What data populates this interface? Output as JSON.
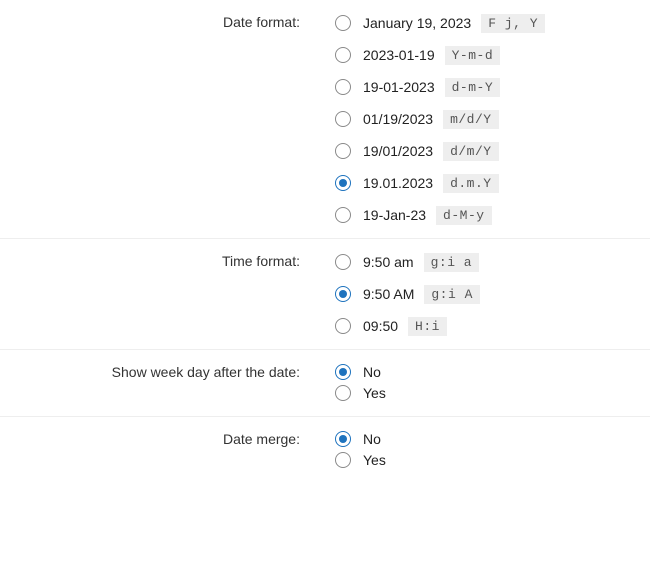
{
  "settings": [
    {
      "label": "Date format:",
      "name": "date-format",
      "tight": false,
      "options": [
        {
          "text": "January 19, 2023",
          "code": "F j, Y",
          "checked": false
        },
        {
          "text": "2023-01-19",
          "code": "Y-m-d",
          "checked": false
        },
        {
          "text": "19-01-2023",
          "code": "d-m-Y",
          "checked": false
        },
        {
          "text": "01/19/2023",
          "code": "m/d/Y",
          "checked": false
        },
        {
          "text": "19/01/2023",
          "code": "d/m/Y",
          "checked": false
        },
        {
          "text": "19.01.2023",
          "code": "d.m.Y",
          "checked": true
        },
        {
          "text": "19-Jan-23",
          "code": "d-M-y",
          "checked": false
        }
      ]
    },
    {
      "label": "Time format:",
      "name": "time-format",
      "tight": false,
      "options": [
        {
          "text": "9:50 am",
          "code": "g:i a",
          "checked": false
        },
        {
          "text": "9:50 AM",
          "code": "g:i A",
          "checked": true
        },
        {
          "text": "09:50",
          "code": "H:i",
          "checked": false
        }
      ]
    },
    {
      "label": "Show week day after the date:",
      "name": "show-week-day",
      "tight": true,
      "options": [
        {
          "text": "No",
          "code": null,
          "checked": true
        },
        {
          "text": "Yes",
          "code": null,
          "checked": false
        }
      ]
    },
    {
      "label": "Date merge:",
      "name": "date-merge",
      "tight": true,
      "options": [
        {
          "text": "No",
          "code": null,
          "checked": true
        },
        {
          "text": "Yes",
          "code": null,
          "checked": false
        }
      ]
    }
  ]
}
